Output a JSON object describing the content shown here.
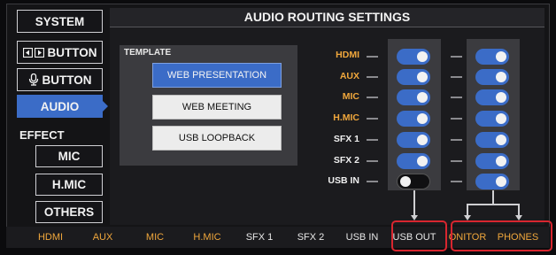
{
  "sidebar": {
    "system": "SYSTEM",
    "button1": "BUTTON",
    "button2": "BUTTON",
    "audio": "AUDIO",
    "effect": "EFFECT",
    "mic": "MIC",
    "hmic": "H.MIC",
    "others": "OTHERS"
  },
  "main": {
    "title": "AUDIO ROUTING SETTINGS",
    "template_label": "TEMPLATE",
    "templates": [
      "WEB PRESENTATION",
      "WEB MEETING",
      "USB LOOPBACK"
    ],
    "sources": [
      "HDMI",
      "AUX",
      "MIC",
      "H.MIC",
      "SFX 1",
      "SFX 2",
      "USB IN"
    ],
    "usb_out_toggles": [
      true,
      true,
      true,
      true,
      true,
      true,
      false
    ],
    "monitor_toggles": [
      true,
      true,
      true,
      true,
      true,
      true,
      true
    ]
  },
  "bottom": {
    "labels": [
      "HDMI",
      "AUX",
      "MIC",
      "H.MIC",
      "SFX 1",
      "SFX 2",
      "USB IN",
      "USB OUT",
      "ONITOR",
      "PHONES"
    ]
  },
  "colors": {
    "accent": "#3b6cc7",
    "orange": "#f0a73c",
    "highlight": "#d8262f"
  }
}
